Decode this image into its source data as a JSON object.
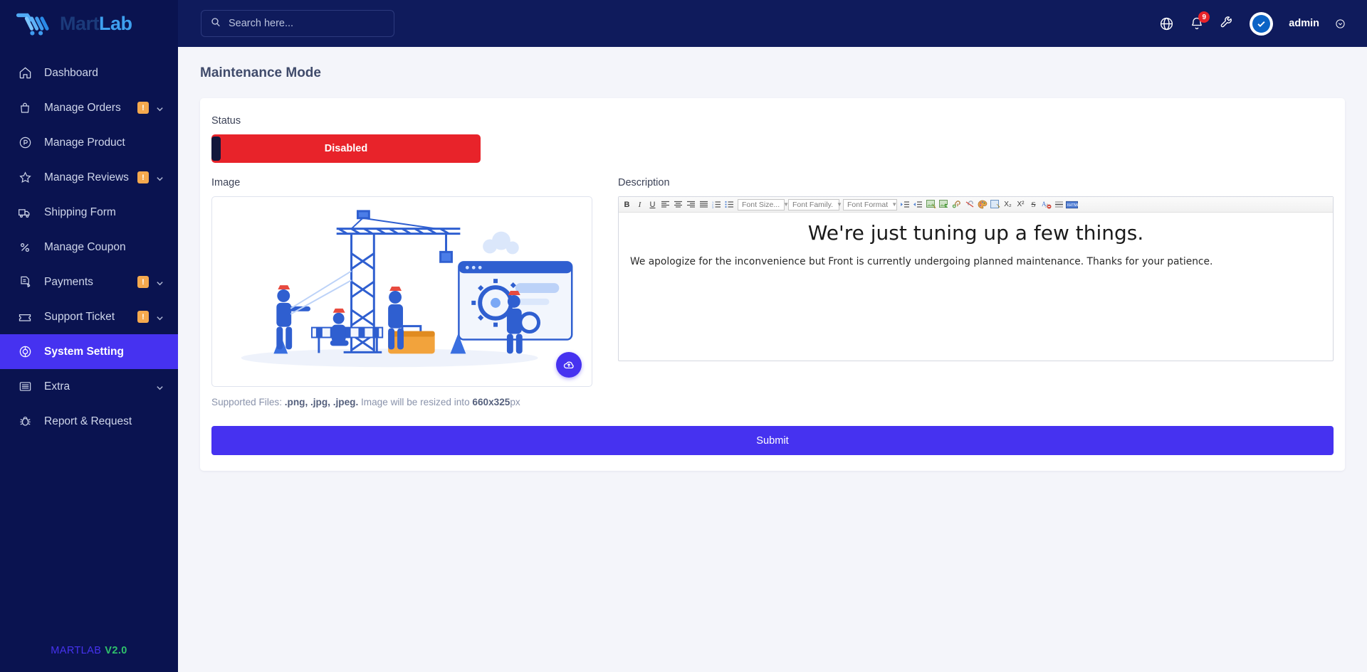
{
  "brand": {
    "name_first": "Mart",
    "name_second": "Lab",
    "logo_icon": "shopping-cart-icon"
  },
  "sidebar": {
    "items": [
      {
        "label": "Dashboard",
        "icon": "home-icon",
        "alert": null,
        "expandable": false,
        "active": false
      },
      {
        "label": "Manage Orders",
        "icon": "bag-icon",
        "alert": "!",
        "expandable": true,
        "active": false
      },
      {
        "label": "Manage Product",
        "icon": "product-circle-icon",
        "alert": null,
        "expandable": false,
        "active": false
      },
      {
        "label": "Manage Reviews",
        "icon": "star-icon",
        "alert": "!",
        "expandable": true,
        "active": false
      },
      {
        "label": "Shipping Form",
        "icon": "truck-icon",
        "alert": null,
        "expandable": false,
        "active": false
      },
      {
        "label": "Manage Coupon",
        "icon": "percent-icon",
        "alert": null,
        "expandable": false,
        "active": false
      },
      {
        "label": "Payments",
        "icon": "invoice-dollar-icon",
        "alert": "!",
        "expandable": true,
        "active": false
      },
      {
        "label": "Support Ticket",
        "icon": "ticket-icon",
        "alert": "!",
        "expandable": true,
        "active": false
      },
      {
        "label": "System Setting",
        "icon": "settings-gear-icon",
        "alert": null,
        "expandable": false,
        "active": true
      },
      {
        "label": "Extra",
        "icon": "list-icon",
        "alert": null,
        "expandable": true,
        "active": false
      },
      {
        "label": "Report & Request",
        "icon": "bug-icon",
        "alert": null,
        "expandable": false,
        "active": false
      }
    ],
    "footer": {
      "name": "MARTLAB",
      "version": "V2.0"
    }
  },
  "topbar": {
    "search": {
      "placeholder": "Search here...",
      "value": "",
      "icon": "search-icon"
    },
    "language_icon": "globe-icon",
    "notifications": {
      "icon": "bell-icon",
      "count": "9"
    },
    "tools_icon": "wrench-icon",
    "user": {
      "name": "admin",
      "avatar_icon": "check-badge-icon",
      "chevron_icon": "chevron-down-icon"
    }
  },
  "page": {
    "title": "Maintenance Mode",
    "status": {
      "label": "Status",
      "value": "Disabled",
      "enabled": false,
      "color": "#e8232a"
    },
    "image": {
      "label": "Image",
      "upload_icon": "cloud-upload-icon",
      "note_prefix": "Supported Files: ",
      "note_formats": ".png, .jpg, .jpeg.",
      "note_middle": " Image will be resized into ",
      "note_size": "660x325",
      "note_suffix": "px"
    },
    "description": {
      "label": "Description",
      "toolbar": {
        "bold": "B",
        "italic": "I",
        "underline": "U",
        "align_left": "align-left-icon",
        "align_center": "align-center-icon",
        "align_right": "align-right-icon",
        "align_justify": "align-justify-icon",
        "ordered_list": "ordered-list-icon",
        "unordered_list": "unordered-list-icon",
        "font_size": "Font Size...",
        "font_family": "Font Family.",
        "font_format": "Font Format",
        "indent": "indent-icon",
        "outdent": "outdent-icon",
        "image": "image-icon",
        "image_advanced": "image-export-icon",
        "link": "link-icon",
        "unlink": "unlink-icon",
        "color": "color-palette-icon",
        "edit": "edit-icon",
        "subscript": "X₂",
        "superscript": "X²",
        "strikethrough": "S",
        "remove_format": "remove-format-icon",
        "horizontal_rule": "horizontal-rule-icon",
        "source": "XHTML"
      },
      "heading": "We're just tuning up a few things.",
      "paragraph": "We apologize for the inconvenience but Front is currently undergoing planned maintenance. Thanks for your patience."
    },
    "submit_label": "Submit"
  },
  "colors": {
    "accent": "#4632f0",
    "sidebar": "#0a1350",
    "topbar": "#0f1b5c",
    "danger": "#e8232a",
    "alert": "#f5a94e"
  }
}
